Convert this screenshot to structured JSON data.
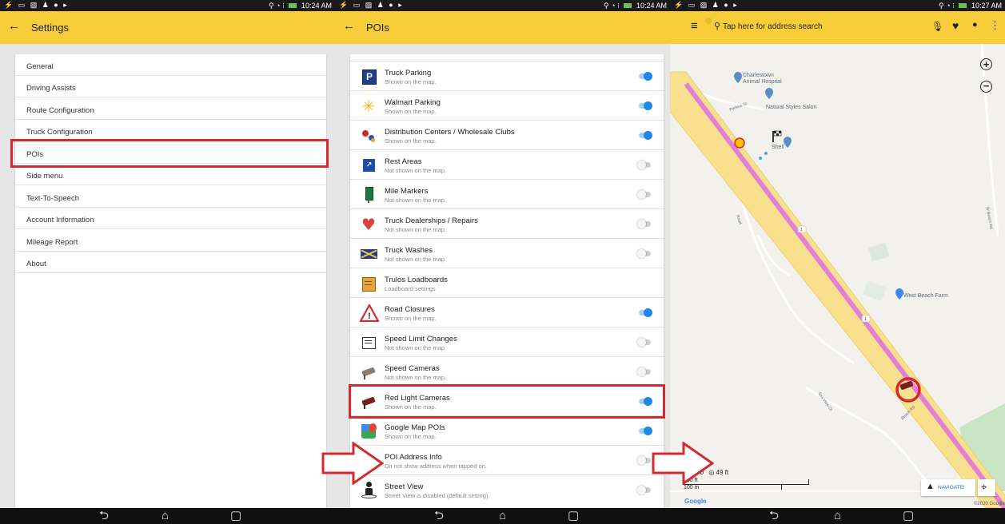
{
  "status_bar": {
    "left_icons": "⚡ ▭ ▨ ♟ ● ▸",
    "indicators": "⚲ ◔ ⁝",
    "time_1": "10:24 AM",
    "time_2": "10:24 AM",
    "time_3": "10:27 AM"
  },
  "settings": {
    "title": "Settings",
    "items": [
      {
        "label": "General"
      },
      {
        "label": "Driving Assists"
      },
      {
        "label": "Route Configuration"
      },
      {
        "label": "Truck Configuration"
      },
      {
        "label": "POIs"
      },
      {
        "label": "Side menu"
      },
      {
        "label": "Text-To-Speech"
      },
      {
        "label": "Account Information"
      },
      {
        "label": "Mileage Report"
      },
      {
        "label": "About"
      }
    ]
  },
  "pois": {
    "title": "POIs",
    "items": [
      {
        "title": "Truck Parking",
        "subtitle": "Shown on the map.",
        "toggle": "on",
        "icon": "truck-parking-icon"
      },
      {
        "title": "Walmart Parking",
        "subtitle": "Shown on the map.",
        "toggle": "on",
        "icon": "walmart-parking-icon"
      },
      {
        "title": "Distribution Centers / Wholesale Clubs",
        "subtitle": "Shown on the map.",
        "toggle": "on",
        "icon": "distribution-center-icon"
      },
      {
        "title": "Rest Areas",
        "subtitle": "Not shown on the map.",
        "toggle": "off",
        "icon": "rest-area-icon"
      },
      {
        "title": "Mile Markers",
        "subtitle": "Not shown on the map.",
        "toggle": "off",
        "icon": "mile-marker-icon"
      },
      {
        "title": "Truck Dealerships / Repairs",
        "subtitle": "Not shown on the map.",
        "toggle": "off",
        "icon": "truck-dealership-icon"
      },
      {
        "title": "Truck Washes",
        "subtitle": "Not shown on the map.",
        "toggle": "off",
        "icon": "truck-wash-icon"
      },
      {
        "title": "Trulos Loadboards",
        "subtitle": "Loadboard settings",
        "toggle": "none",
        "icon": "loadboard-icon"
      },
      {
        "title": "Road Closures",
        "subtitle": "Shown on the map.",
        "toggle": "on",
        "icon": "road-closure-icon"
      },
      {
        "title": "Speed Limit Changes",
        "subtitle": "Not shown on the map.",
        "toggle": "off",
        "icon": "speed-limit-icon"
      },
      {
        "title": "Speed Cameras",
        "subtitle": "Not shown on the map.",
        "toggle": "off",
        "icon": "speed-camera-icon"
      },
      {
        "title": "Red Light Cameras",
        "subtitle": "Shown on the map.",
        "toggle": "on",
        "icon": "red-light-camera-icon"
      },
      {
        "title": "Google Map POIs",
        "subtitle": "Shown on the map.",
        "toggle": "on",
        "icon": "google-maps-icon"
      },
      {
        "title": "POI Address Info",
        "subtitle": "Do not show address when tapped on.",
        "toggle": "off",
        "icon": "info-icon"
      },
      {
        "title": "Street View",
        "subtitle": "Street View is disabled (default setting).",
        "toggle": "off",
        "icon": "street-view-icon"
      }
    ]
  },
  "map": {
    "search_placeholder": "Tap here for address search",
    "labels": {
      "animal_hospital_1": "Charlestown",
      "animal_hospital_2": "Animal Hospital",
      "salon": "Natural Styles Salon",
      "shell": "Shell",
      "farm": "West Beach Farm",
      "perkins_st": "Perkins St",
      "route_1": "1",
      "sea_view_dr": "Sea View Dr",
      "beach_rd": "Beach Rd",
      "w_beach_rd": "W Beach Rd",
      "road": "Road"
    },
    "counters": {
      "ft_prefix": "ft",
      "count": "0",
      "distance": "49 ft"
    },
    "scale": {
      "imperial": "400 ft",
      "metric": "100 m"
    },
    "navigate_label": "NAVIGATE!",
    "google": "Google",
    "copyright": "©2020 Google"
  },
  "colors": {
    "accent_yellow": "#f7cd3a",
    "toggle_on": "#1e88e5",
    "highlight_red": "#d42a2f",
    "route_pink": "#e47fd6",
    "highway_yellow": "#f8e08f"
  }
}
